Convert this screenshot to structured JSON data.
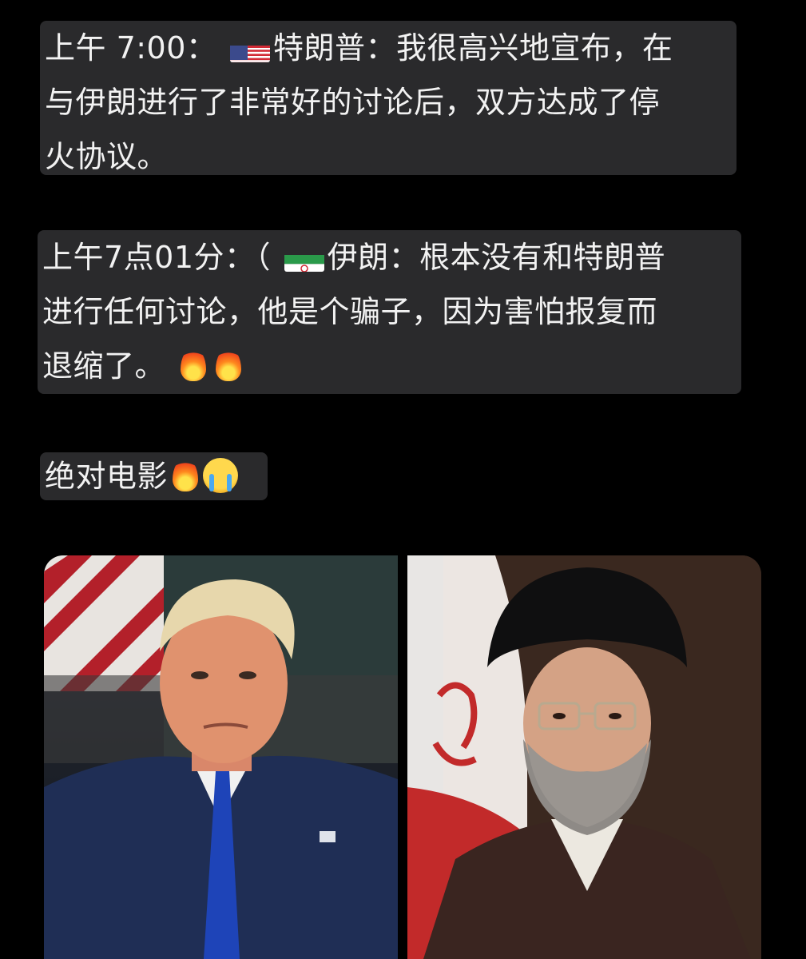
{
  "messages": [
    {
      "lines": [
        "上午 7:00： ",
        "特朗普：我很高兴地宣布，在",
        "与伊朗进行了非常好的讨论后，双方达成了停",
        "火协议。"
      ],
      "flag": "us-flag-icon"
    },
    {
      "lines": [
        "上午7点01分：（ ",
        "伊朗：根本没有和特朗普",
        "进行任何讨论，他是个骗子，因为害怕报复而",
        "退缩了。"
      ],
      "flag": "iran-flag-icon",
      "trailing_icons": [
        "fire-icon",
        "fire-icon"
      ]
    },
    {
      "lines": [
        "绝对电影"
      ],
      "trailing_icons": [
        "fire-icon",
        "crying-face-icon"
      ]
    }
  ],
  "images": [
    {
      "subject": "portrait-left"
    },
    {
      "subject": "portrait-right"
    }
  ],
  "colors": {
    "background": "#000000",
    "bubble": "#2a2a2c",
    "text": "#f2f2f2"
  }
}
